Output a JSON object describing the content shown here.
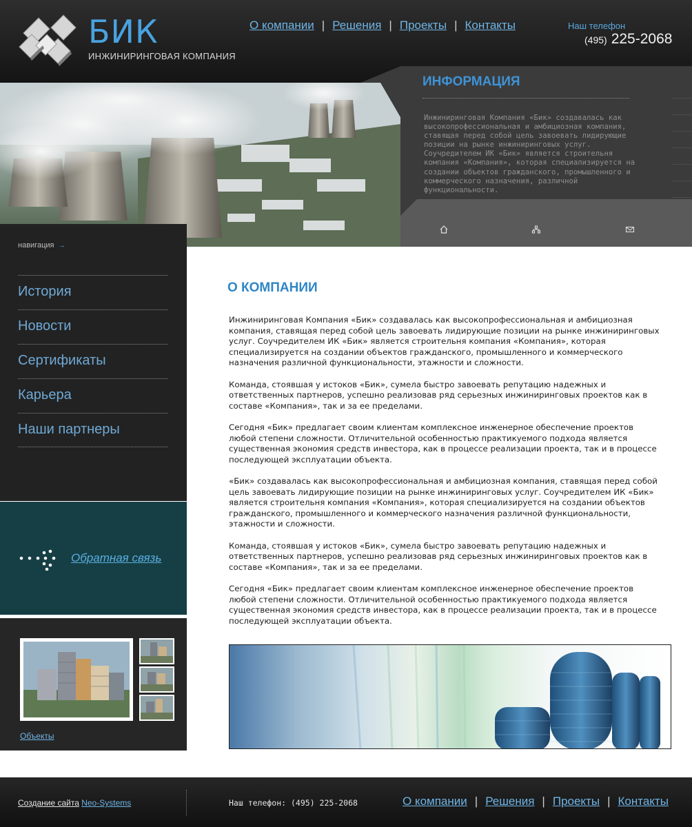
{
  "header": {
    "logo_title": "БИК",
    "logo_subtitle": "ИНЖИНИРИНГОВАЯ КОМПАНИЯ",
    "nav": [
      "О компании",
      "Решения",
      "Проекты",
      "Контакты"
    ],
    "phone_label": "Наш телефон",
    "phone_code": "(495)",
    "phone_number": "225-2068"
  },
  "info": {
    "title": "ИНФОРМАЦИЯ",
    "text": "Инжиниринговая Компания «Бик» создавалась как высокопрофессиональная и амбициозная компания, ставящая перед собой цель завоевать лидирующие позиции на рынке инжиниринговых услуг. Соучредителем ИК «Бик» является строительня компания «Компания», которая специализируется на создании объектов гражданского, промышленного и коммерческого назначения, различной функциональности.",
    "icons": [
      "home-icon",
      "sitemap-icon",
      "mail-icon"
    ]
  },
  "sidebar": {
    "nav_heading": "навигация",
    "nav_arrow": "→",
    "items": [
      "История",
      "Новости",
      "Сертификаты",
      "Карьера",
      "Наши партнеры"
    ],
    "feedback_label": "Обратная связь",
    "gallery_label": "Объекты"
  },
  "main": {
    "title": "О КОМПАНИИ",
    "paragraphs": [
      "Инжиниринговая Компания «Бик» создавалась как высокопрофессиональная и амбициозная компания, ставящая перед собой цель завоевать лидирующие позиции на рынке инжиниринговых услуг. Соучредителем ИК «Бик» является строительня компания «Компания», которая специализируется на создании объектов гражданского, промышленного и коммерческого назначения различной функциональности, этажности и сложности.",
      "Команда, стоявшая у истоков «Бик», сумела быстро завоевать репутацию надежных и ответственных партнеров, успешно реализовав ряд серьезных инжиниринговых проектов как в составе «Компания», так и за ее пределами.",
      "Сегодня «Бик» предлагает своим клиентам комплексное инженерное обеспечение проектов любой степени сложности. Отличительной особенностью практикуемого подхода является существенная экономия средств инвестора, как в процессе реализации проекта, так и в процессе последующей эксплуатации объекта.",
      "«Бик» создавалась как высокопрофессиональная и амбициозная компания, ставящая перед собой цель завоевать лидирующие позиции на рынке инжиниринговых услуг. Соучредителем ИК «Бик» является строительня компания «Компания», которая специализируется на создании объектов гражданского, промышленного и коммерческого назначения различной функциональности, этажности и сложности.",
      "Команда, стоявшая у истоков «Бик», сумела быстро завоевать репутацию надежных и ответственных партнеров, успешно реализовав ряд серьезных инжиниринговых проектов как в составе «Компания», так и за ее пределами.",
      "Сегодня «Бик» предлагает своим клиентам комплексное инженерное обеспечение проектов любой степени сложности. Отличительной особенностью практикуемого подхода является существенная экономия средств инвестора, как в процессе реализации проекта, так и в процессе последующей эксплуатации объекта."
    ]
  },
  "footer": {
    "credit_text": "Создание сайта",
    "credit_link": "Neo-Systems",
    "phone": "Наш телефон: (495)  225-2068",
    "nav": [
      "О компании",
      "Решения",
      "Проекты",
      "Контакты"
    ]
  },
  "colors": {
    "accent": "#49a2e0",
    "dark_bg": "#222222",
    "feedback_bg": "#163f45",
    "link": "#6fb5e6"
  }
}
